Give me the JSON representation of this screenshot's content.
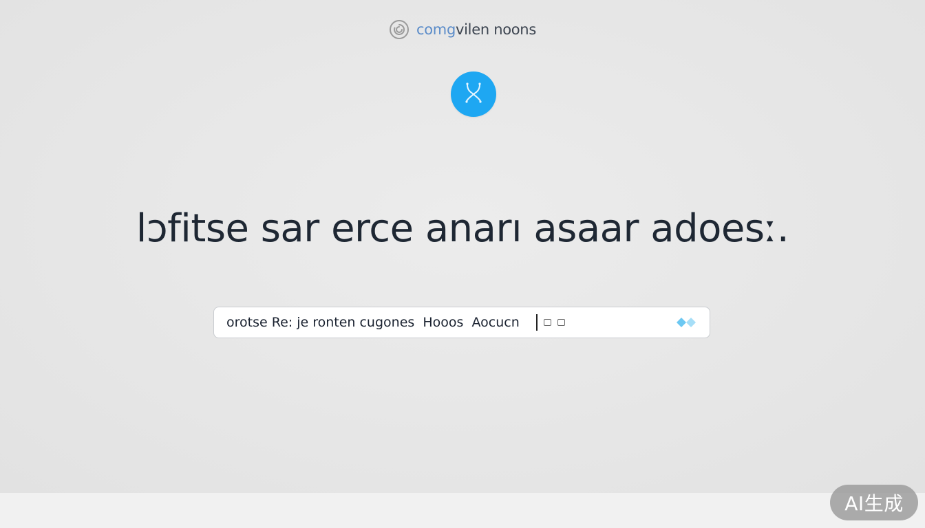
{
  "brand": {
    "name_accent": "comg",
    "name_rest": "vilen noons",
    "logo_icon": "spiral-icon",
    "logo_color": "#9a9a9a"
  },
  "hero": {
    "logo_icon": "stethoscope-icon",
    "logo_color": "#1ea7f2",
    "headline": "lɔfitse sar erce  anarı asaar adoesː."
  },
  "search": {
    "value": "orotse Re: je ronten cugones  Hooos  Aocucn",
    "placeholder": "",
    "submit_icon": "diamond-pair-icon",
    "submit_color": "#6cc8f2"
  },
  "watermark": {
    "label": "AI生成"
  }
}
